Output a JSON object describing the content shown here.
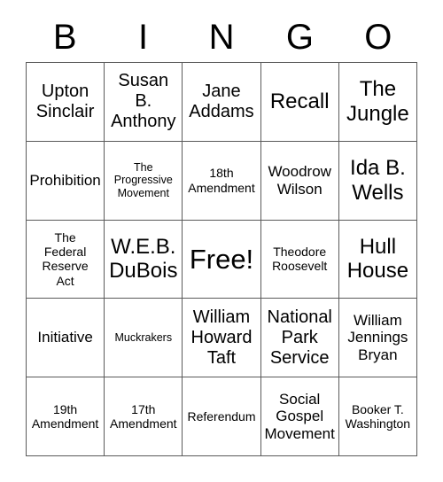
{
  "card": {
    "title": "BINGO",
    "header_letters": [
      "B",
      "I",
      "N",
      "G",
      "O"
    ],
    "colors": {
      "border": "#5a5a5a",
      "background": "#ffffff",
      "text": "#000000"
    },
    "grid": {
      "rows": 5,
      "columns": 5,
      "free_space": "Free!",
      "free_space_position": "center"
    },
    "cells": [
      {
        "text": "Upton\nSinclair",
        "size": "l"
      },
      {
        "text": "Susan\nB.\nAnthony",
        "size": "l"
      },
      {
        "text": "Jane\nAddams",
        "size": "l"
      },
      {
        "text": "Recall",
        "size": "xl"
      },
      {
        "text": "The\nJungle",
        "size": "xl"
      },
      {
        "text": "Prohibition",
        "size": "m"
      },
      {
        "text": "The\nProgressive\nMovement",
        "size": "xs"
      },
      {
        "text": "18th\nAmendment",
        "size": "s"
      },
      {
        "text": "Woodrow\nWilson",
        "size": "m"
      },
      {
        "text": "Ida B.\nWells",
        "size": "xl"
      },
      {
        "text": "The\nFederal\nReserve\nAct",
        "size": "s"
      },
      {
        "text": "W.E.B.\nDuBois",
        "size": "xl"
      },
      {
        "text": "Free!",
        "size": "xxl"
      },
      {
        "text": "Theodore\nRoosevelt",
        "size": "s"
      },
      {
        "text": "Hull\nHouse",
        "size": "xl"
      },
      {
        "text": "Initiative",
        "size": "m"
      },
      {
        "text": "Muckrakers",
        "size": "xs"
      },
      {
        "text": "William\nHoward\nTaft",
        "size": "l"
      },
      {
        "text": "National\nPark\nService",
        "size": "l"
      },
      {
        "text": "William\nJennings\nBryan",
        "size": "m"
      },
      {
        "text": "19th\nAmendment",
        "size": "s"
      },
      {
        "text": "17th\nAmendment",
        "size": "s"
      },
      {
        "text": "Referendum",
        "size": "s"
      },
      {
        "text": "Social\nGospel\nMovement",
        "size": "m"
      },
      {
        "text": "Booker T.\nWashington",
        "size": "s"
      }
    ]
  }
}
